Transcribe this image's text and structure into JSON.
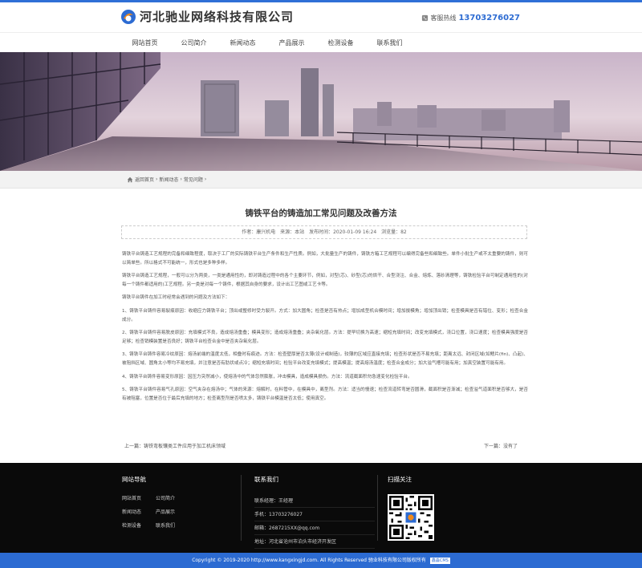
{
  "header": {
    "company": "河北驰业网络科技有限公司",
    "hotline_label": "客服热线",
    "hotline_number": "13703276027"
  },
  "nav": {
    "items": [
      "网站首页",
      "公司简介",
      "新闻动态",
      "产品展示",
      "检测设备",
      "联系我们"
    ]
  },
  "breadcrumb": {
    "items": [
      "返回首页",
      "新闻动态",
      "常见问题"
    ],
    "separator": "›"
  },
  "article": {
    "title": "铸铁平台的铸造加工常见问题及改善方法",
    "author": "作者：康兴机电",
    "source": "来源：本站",
    "published": "发布时间：2020-01-09 16:24",
    "views": "浏览量：82",
    "paragraphs": [
      "铸铁平台铸造工艺规程的完备和细致程度，取决于工厂的实际铸铁平台生产条件和生产性质。例如，大批量生产的铸件，铸铁方箱工艺规程可以编得完备些和细致些。单件小批生产或不太重要的铸件，则可以简单些。所以格式不可能统一，形式也是多种多样。",
      "铸铁平台铸造工艺规程，一般可以分为两类，一类是通用性的，即对铸造过程中的各个主要环节，例如，对型(芯)、砂型(芯)的烘干、合型浇注、合金、熔炼、落砂清理等，铸铁检验平台可制定通用性的(对每一个铸件都适用的)工艺规程。另一类是对每一个铸件，根据其自身的要求，设计出工艺图或工艺卡等。",
      "铸铁平台铸件在加工时经常会遇到的问题及方法如下：",
      "1、铸铁平台铸件容易裂痕原因：收缩应力铸铁平台；顶出或整修时受力裂开。方式：加大圆角；检查是否有热点；增加成型机合模时间；增加拔模角；增加顶出销；检查模具是否有错位、变形；检查合金成分。",
      "2、铸铁平台铸件容易脱皮原因：充填模式不良，造成熔汤重叠；模具变形；造成熔汤重叠；夹杂氧化层。方法：提早切换为高速；缩短充填时间；改变充填模式，浇口位置，浇口速度；检查模具强度是否足够；检查销模装置是否良好；铸铁平台检查合金中是否夹杂氧化层。",
      "3、铸铁平台铸件容易冷纹原因：熔汤前端的温度太低，相叠时有痕迹。方法：检查壁厚是否太薄(设计或制造)，较薄的区域应直接充填；检查形状是否不易充填；距离太远、封闭区域(如鳍片(fin)、凸起)、被阻挡区域、圆角太小等均不易充填，并注意是否有肋状或点冷；缩短充填时间；检验平台改变充填模式；提高模温；提高熔汤温度；检查合金成分；加大溢气槽可能有用；加真空装置可能有用。",
      "4、铸铁平台铸件容易变形原因：因压力突然减小，使熔汤中的气体忽然膨胀，冲击模具，造成模具损伤。方法：流道截面积勿急速变化检验平台。",
      "5、铸铁平台铸件容易气孔原因：空气夹杂在熔汤中；气体的来源：熔解时，在料管中，在模具中，离型剂。方法：适当的慢速；检查流道转弯是否圆滑，截面积是否渐减；检查溢气道面积是否够大，是否有被阻塞，位置是否位于最后充填的地方；检查离型剂是否喷太多，铸铁平台模温是否太低；使用真空。"
    ],
    "prev": "上一篇：铸铁弯板镶类工件应用于加工机床领域",
    "next": "下一篇：没有了"
  },
  "footer": {
    "nav_title": "网站导航",
    "nav_links": [
      "网站首页",
      "公司简介",
      "新闻动态",
      "产品展示",
      "检测设备",
      "联系我们"
    ],
    "contact_title": "联系我们",
    "contacts": [
      "联系经理：王经理",
      "手机：13703276027",
      "邮箱：2687215XX@qq.com",
      "地址：河北省沧州市泊头市经济开发区"
    ],
    "qr_title": "扫描关注",
    "copyright": "Copyright © 2019-2020 http://www.kangxingjd.com. All Rights Reserved 驰业科技有限公司版权所有",
    "badge": "鑫淼CMS"
  },
  "colors": {
    "brand_blue": "#2c6bd2",
    "footer_bg": "#0a0a0a",
    "crumb_bg": "#f2f2f2"
  }
}
